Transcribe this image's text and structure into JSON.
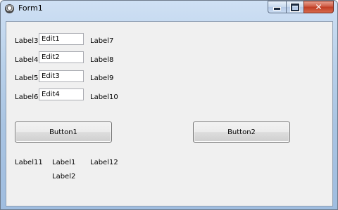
{
  "window": {
    "title": "Form1",
    "icon": "form-app-icon",
    "controls": {
      "minimize": "minimize-icon",
      "maximize": "maximize-icon",
      "close": "close-icon"
    }
  },
  "form": {
    "labels": {
      "label1": "Label1",
      "label2": "Label2",
      "label3": "Label3",
      "label4": "Label4",
      "label5": "Label5",
      "label6": "Label6",
      "label7": "Label7",
      "label8": "Label8",
      "label9": "Label9",
      "label10": "Label10",
      "label11": "Label11",
      "label12": "Label12"
    },
    "edits": {
      "edit1": "Edit1",
      "edit2": "Edit2",
      "edit3": "Edit3",
      "edit4": "Edit4"
    },
    "buttons": {
      "button1": "Button1",
      "button2": "Button2"
    }
  },
  "colors": {
    "titlebar": "#b9d1ea",
    "client_background": "#f0f0f0",
    "close_button": "#c03d24"
  }
}
